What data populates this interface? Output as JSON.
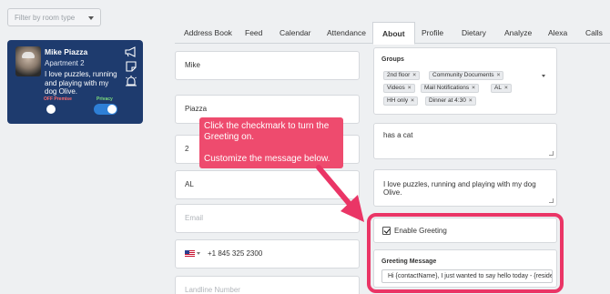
{
  "filter": {
    "placeholder": "Filter by room type"
  },
  "card": {
    "name": "Mike Piazza",
    "apartment": "Apartment 2",
    "bio": "I love puzzles, running and playing with my dog Olive.",
    "off_label": "OFF Premise",
    "privacy_label": "Privacy",
    "off_premise_on": false,
    "privacy_on": true,
    "icons": [
      "megaphone-icon",
      "note-icon",
      "alarm-icon"
    ]
  },
  "tabs": [
    "Address Book",
    "Feed",
    "Calendar",
    "Attendance",
    "About",
    "Profile",
    "Dietary",
    "Analyze",
    "Alexa",
    "Calls"
  ],
  "active_tab": "About",
  "fields": {
    "first_name": "Mike",
    "last_name": "Piazza",
    "apartment": "2",
    "state": "AL",
    "email_placeholder": "Email",
    "phone": "+1 845 325 2300",
    "landline_placeholder": "Landline Number"
  },
  "groups": {
    "title": "Groups",
    "chips": [
      "2nd floor",
      "Community Documents",
      "Videos",
      "Mail Notifications",
      "AL",
      "HH only",
      "Dinner at 4:30"
    ]
  },
  "notes": {
    "note1": "has a cat",
    "note2": "I love puzzles, running and playing with my dog Olive."
  },
  "greeting": {
    "enable_label": "Enable Greeting",
    "enabled": true,
    "message_title": "Greeting Message",
    "message_value": "Hi {contactName}, I just wanted to say hello today - {residentName}"
  },
  "callout": {
    "line1": "Click the checkmark to turn the Greeting on.",
    "line2": "Customize the message below."
  },
  "colors": {
    "card": "#1e3b6e",
    "accent": "#ea3566",
    "callout": "#ee4b6e",
    "toggle_on": "#2e7fd6"
  }
}
